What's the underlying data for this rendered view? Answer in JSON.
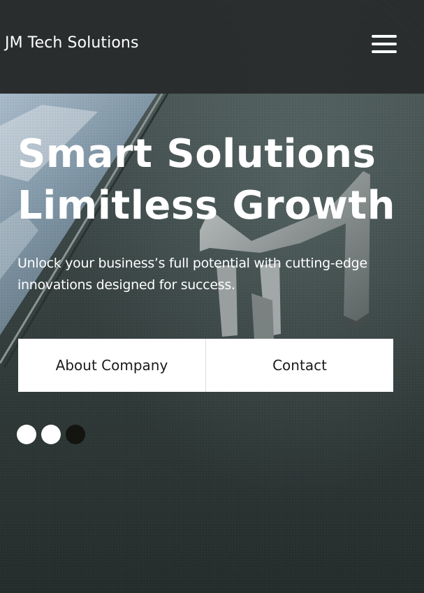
{
  "header": {
    "brand": "JM Tech Solutions",
    "menu_icon": "hamburger-menu-icon"
  },
  "hero": {
    "headline_line1": "Smart Solutions",
    "headline_line2": "Limitless Growth",
    "subtext": "Unlock your business’s full potential with cutting-edge innovations designed for success.",
    "buttons": [
      {
        "label": "About Company"
      },
      {
        "label": "Contact"
      }
    ]
  },
  "slider": {
    "slide_count": 3,
    "active_index": 2
  },
  "colors": {
    "topbar": "#282a2b",
    "text": "#ffffff",
    "button_bg": "#ffffff",
    "button_text": "#1a1a1a",
    "dot_active": "#141410",
    "dot_inactive": "#ffffff"
  }
}
